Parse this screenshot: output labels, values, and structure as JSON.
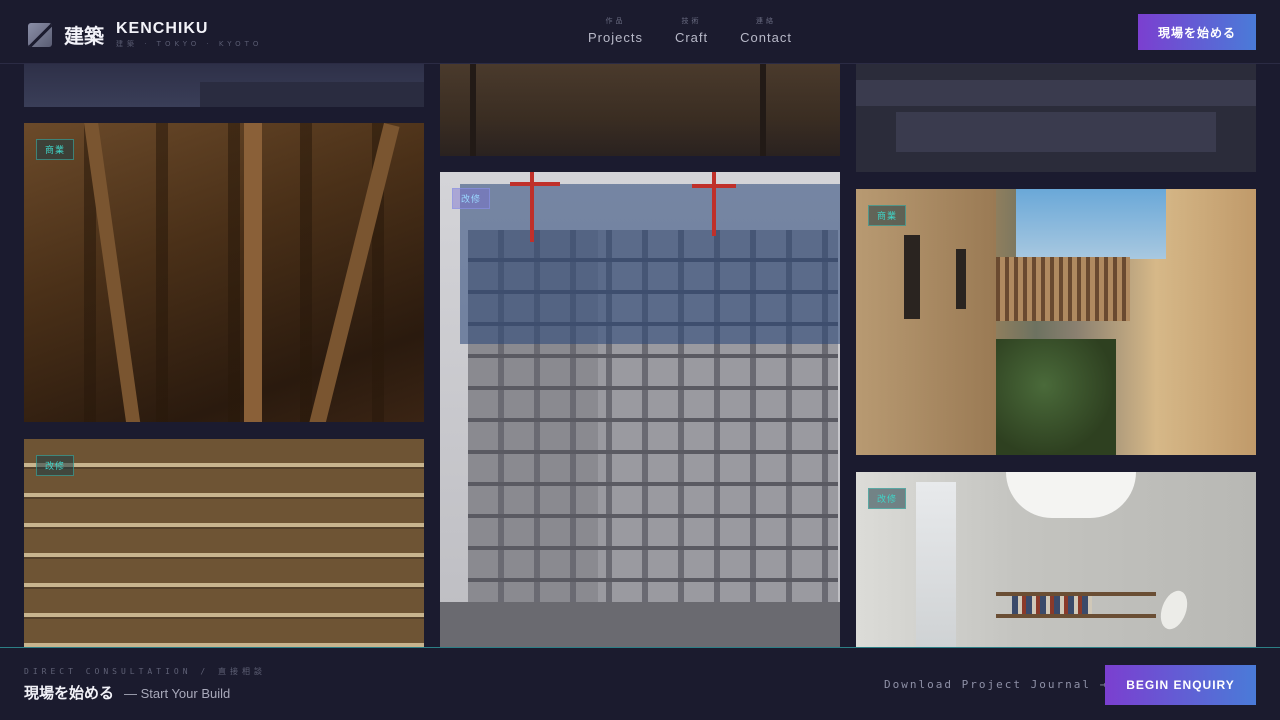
{
  "header": {
    "brand_jp": "建築",
    "brand_en": "KENCHIKU",
    "brand_sub": "建築 · TOKYO · KYOTO",
    "nav": [
      {
        "jp": "作品",
        "label": "Projects"
      },
      {
        "jp": "技術",
        "label": "Craft"
      },
      {
        "jp": "連絡",
        "label": "Contact"
      }
    ],
    "cta_label": "現場を始める"
  },
  "gallery": {
    "tiles": [
      {
        "name": "wood-beams",
        "tag": "商業"
      },
      {
        "name": "wood-planks",
        "tag": "改修"
      },
      {
        "name": "building-construction",
        "tag": "改修"
      },
      {
        "name": "courtyard",
        "tag": "商業"
      },
      {
        "name": "concrete-interior",
        "tag": "改修"
      }
    ]
  },
  "footer": {
    "kicker": "DIRECT CONSULTATION / 直接相談",
    "title_jp": "現場を始める",
    "title_en": "— Start Your Build",
    "download_label": "Download Project Journal →",
    "enquiry_label": "BEGIN ENQUIRY"
  },
  "colors": {
    "background": "#1b1b2f",
    "accent_start": "#7b3fd0",
    "accent_end": "#4a7bd8",
    "tag_teal": "#3fd5c8"
  }
}
